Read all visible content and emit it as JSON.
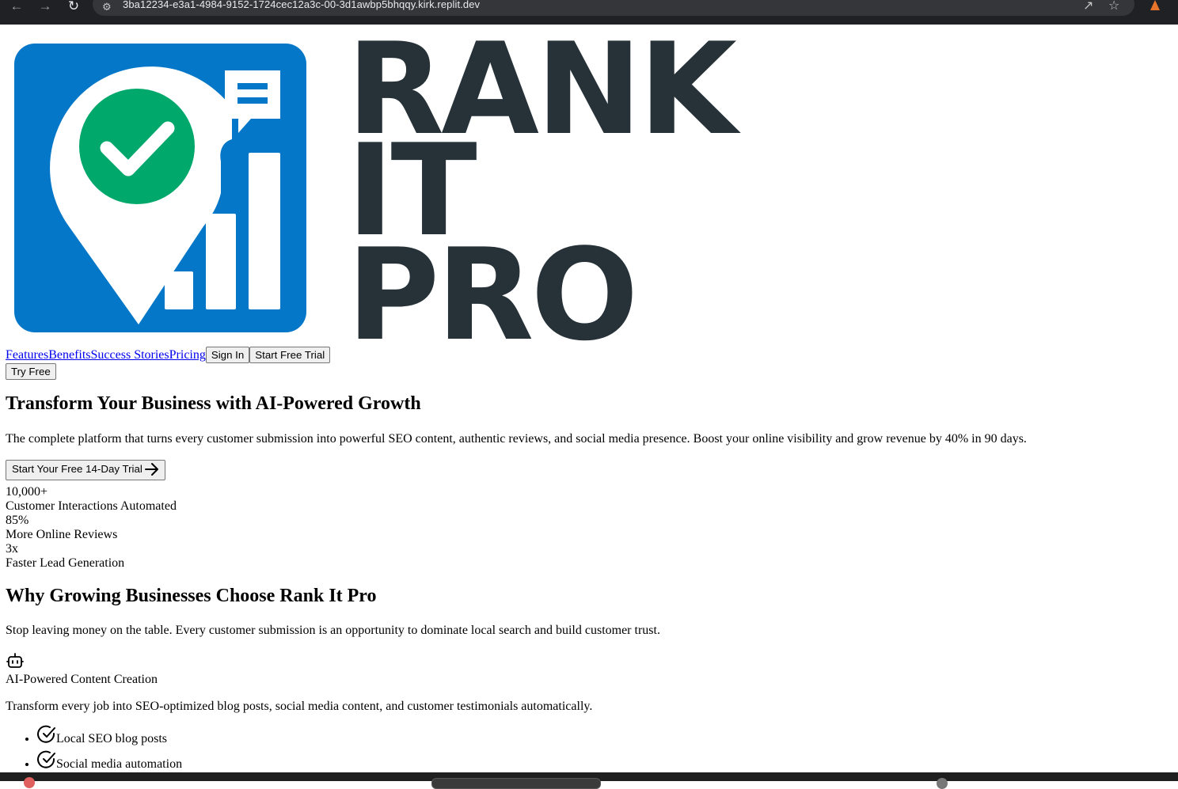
{
  "browser": {
    "url": "3ba12234-e3a1-4984-9152-1724cec12a3c-00-3d1awbp5bhqqy.kirk.replit.dev",
    "back_icon": "arrow-left-icon",
    "forward_icon": "arrow-right-icon",
    "reload_icon": "reload-icon"
  },
  "logo": {
    "line1": "RANK",
    "line2": "IT",
    "line3": "PRO",
    "colors": {
      "tile": "#0477c8",
      "check": "#00a86b",
      "text": "#263238"
    }
  },
  "nav": {
    "links": [
      "Features",
      "Benefits",
      "Success Stories",
      "Pricing"
    ],
    "sign_in": "Sign In",
    "start_trial": "Start Free Trial",
    "try_free": "Try Free"
  },
  "hero": {
    "title": "Transform Your Business with AI-Powered Growth",
    "subtitle": "The complete platform that turns every customer submission into powerful SEO content, authentic reviews, and social media presence. Boost your online visibility and grow revenue by 40% in 90 days.",
    "cta": "Start Your Free 14-Day Trial"
  },
  "stats": [
    {
      "value": "10,000+",
      "label": "Customer Interactions Automated"
    },
    {
      "value": "85%",
      "label": "More Online Reviews"
    },
    {
      "value": "3x",
      "label": "Faster Lead Generation"
    }
  ],
  "why": {
    "title": "Why Growing Businesses Choose Rank It Pro",
    "subtitle": "Stop leaving money on the table. Every customer submission is an opportunity to dominate local search and build customer trust."
  },
  "feature": {
    "icon": "bot-icon",
    "title": "AI-Powered Content Creation",
    "description": "Transform every job into SEO-optimized blog posts, social media content, and customer testimonials automatically.",
    "points": [
      "Local SEO blog posts",
      "Social media automation"
    ]
  }
}
